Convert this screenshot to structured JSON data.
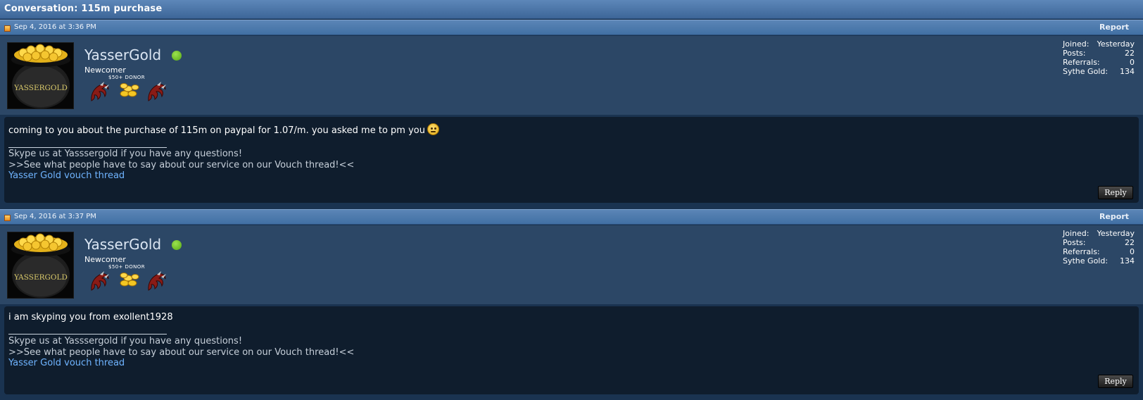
{
  "conversation": {
    "title": "Conversation: 115m purchase"
  },
  "colors": {
    "online": "#6dc024",
    "link": "#6fb4ff",
    "header": "#4a76aa"
  },
  "posts": [
    {
      "date": "Sep 4, 2016 at 3:36 PM",
      "report_label": "Report",
      "user": {
        "avatar_text": "YASSERGOLD",
        "name": "YasserGold",
        "title": "Newcomer",
        "donor_label": "$50+ DONOR",
        "online": true
      },
      "stats": [
        {
          "label": "Joined:",
          "value": "Yesterday"
        },
        {
          "label": "Posts:",
          "value": "22"
        },
        {
          "label": "Referrals:",
          "value": "0"
        },
        {
          "label": "Sythe Gold:",
          "value": "134"
        }
      ],
      "message": "coming to you about the purchase of 115m on paypal for 1.07/m. you asked me to pm you",
      "emoji": "smile-emoji",
      "signature": {
        "line1": "Skype us at Yasssergold if you have any questions!",
        "line2": ">>See what people have to say about our service on our Vouch thread!<<",
        "link": "Yasser Gold vouch thread"
      },
      "reply_label": "Reply"
    },
    {
      "date": "Sep 4, 2016 at 3:37 PM",
      "report_label": "Report",
      "user": {
        "avatar_text": "YASSERGOLD",
        "name": "YasserGold",
        "title": "Newcomer",
        "donor_label": "$50+ DONOR",
        "online": true
      },
      "stats": [
        {
          "label": "Joined:",
          "value": "Yesterday"
        },
        {
          "label": "Posts:",
          "value": "22"
        },
        {
          "label": "Referrals:",
          "value": "0"
        },
        {
          "label": "Sythe Gold:",
          "value": "134"
        }
      ],
      "message": "i am skyping you from exollent1928",
      "signature": {
        "line1": "Skype us at Yasssergold if you have any questions!",
        "line2": ">>See what people have to say about our service on our Vouch thread!<<",
        "link": "Yasser Gold vouch thread"
      },
      "reply_label": "Reply"
    }
  ]
}
